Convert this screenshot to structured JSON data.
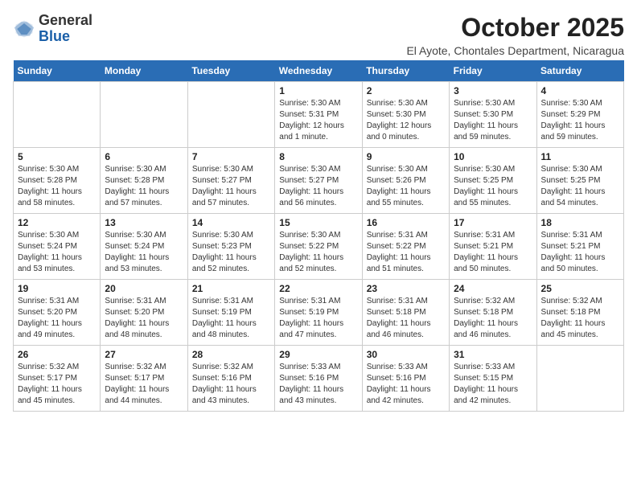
{
  "header": {
    "logo_general": "General",
    "logo_blue": "Blue",
    "month_year": "October 2025",
    "location": "El Ayote, Chontales Department, Nicaragua"
  },
  "days_of_week": [
    "Sunday",
    "Monday",
    "Tuesday",
    "Wednesday",
    "Thursday",
    "Friday",
    "Saturday"
  ],
  "weeks": [
    [
      {
        "day": "",
        "info": ""
      },
      {
        "day": "",
        "info": ""
      },
      {
        "day": "",
        "info": ""
      },
      {
        "day": "1",
        "info": "Sunrise: 5:30 AM\nSunset: 5:31 PM\nDaylight: 12 hours\nand 1 minute."
      },
      {
        "day": "2",
        "info": "Sunrise: 5:30 AM\nSunset: 5:30 PM\nDaylight: 12 hours\nand 0 minutes."
      },
      {
        "day": "3",
        "info": "Sunrise: 5:30 AM\nSunset: 5:30 PM\nDaylight: 11 hours\nand 59 minutes."
      },
      {
        "day": "4",
        "info": "Sunrise: 5:30 AM\nSunset: 5:29 PM\nDaylight: 11 hours\nand 59 minutes."
      }
    ],
    [
      {
        "day": "5",
        "info": "Sunrise: 5:30 AM\nSunset: 5:28 PM\nDaylight: 11 hours\nand 58 minutes."
      },
      {
        "day": "6",
        "info": "Sunrise: 5:30 AM\nSunset: 5:28 PM\nDaylight: 11 hours\nand 57 minutes."
      },
      {
        "day": "7",
        "info": "Sunrise: 5:30 AM\nSunset: 5:27 PM\nDaylight: 11 hours\nand 57 minutes."
      },
      {
        "day": "8",
        "info": "Sunrise: 5:30 AM\nSunset: 5:27 PM\nDaylight: 11 hours\nand 56 minutes."
      },
      {
        "day": "9",
        "info": "Sunrise: 5:30 AM\nSunset: 5:26 PM\nDaylight: 11 hours\nand 55 minutes."
      },
      {
        "day": "10",
        "info": "Sunrise: 5:30 AM\nSunset: 5:25 PM\nDaylight: 11 hours\nand 55 minutes."
      },
      {
        "day": "11",
        "info": "Sunrise: 5:30 AM\nSunset: 5:25 PM\nDaylight: 11 hours\nand 54 minutes."
      }
    ],
    [
      {
        "day": "12",
        "info": "Sunrise: 5:30 AM\nSunset: 5:24 PM\nDaylight: 11 hours\nand 53 minutes."
      },
      {
        "day": "13",
        "info": "Sunrise: 5:30 AM\nSunset: 5:24 PM\nDaylight: 11 hours\nand 53 minutes."
      },
      {
        "day": "14",
        "info": "Sunrise: 5:30 AM\nSunset: 5:23 PM\nDaylight: 11 hours\nand 52 minutes."
      },
      {
        "day": "15",
        "info": "Sunrise: 5:30 AM\nSunset: 5:22 PM\nDaylight: 11 hours\nand 52 minutes."
      },
      {
        "day": "16",
        "info": "Sunrise: 5:31 AM\nSunset: 5:22 PM\nDaylight: 11 hours\nand 51 minutes."
      },
      {
        "day": "17",
        "info": "Sunrise: 5:31 AM\nSunset: 5:21 PM\nDaylight: 11 hours\nand 50 minutes."
      },
      {
        "day": "18",
        "info": "Sunrise: 5:31 AM\nSunset: 5:21 PM\nDaylight: 11 hours\nand 50 minutes."
      }
    ],
    [
      {
        "day": "19",
        "info": "Sunrise: 5:31 AM\nSunset: 5:20 PM\nDaylight: 11 hours\nand 49 minutes."
      },
      {
        "day": "20",
        "info": "Sunrise: 5:31 AM\nSunset: 5:20 PM\nDaylight: 11 hours\nand 48 minutes."
      },
      {
        "day": "21",
        "info": "Sunrise: 5:31 AM\nSunset: 5:19 PM\nDaylight: 11 hours\nand 48 minutes."
      },
      {
        "day": "22",
        "info": "Sunrise: 5:31 AM\nSunset: 5:19 PM\nDaylight: 11 hours\nand 47 minutes."
      },
      {
        "day": "23",
        "info": "Sunrise: 5:31 AM\nSunset: 5:18 PM\nDaylight: 11 hours\nand 46 minutes."
      },
      {
        "day": "24",
        "info": "Sunrise: 5:32 AM\nSunset: 5:18 PM\nDaylight: 11 hours\nand 46 minutes."
      },
      {
        "day": "25",
        "info": "Sunrise: 5:32 AM\nSunset: 5:18 PM\nDaylight: 11 hours\nand 45 minutes."
      }
    ],
    [
      {
        "day": "26",
        "info": "Sunrise: 5:32 AM\nSunset: 5:17 PM\nDaylight: 11 hours\nand 45 minutes."
      },
      {
        "day": "27",
        "info": "Sunrise: 5:32 AM\nSunset: 5:17 PM\nDaylight: 11 hours\nand 44 minutes."
      },
      {
        "day": "28",
        "info": "Sunrise: 5:32 AM\nSunset: 5:16 PM\nDaylight: 11 hours\nand 43 minutes."
      },
      {
        "day": "29",
        "info": "Sunrise: 5:33 AM\nSunset: 5:16 PM\nDaylight: 11 hours\nand 43 minutes."
      },
      {
        "day": "30",
        "info": "Sunrise: 5:33 AM\nSunset: 5:16 PM\nDaylight: 11 hours\nand 42 minutes."
      },
      {
        "day": "31",
        "info": "Sunrise: 5:33 AM\nSunset: 5:15 PM\nDaylight: 11 hours\nand 42 minutes."
      },
      {
        "day": "",
        "info": ""
      }
    ]
  ]
}
